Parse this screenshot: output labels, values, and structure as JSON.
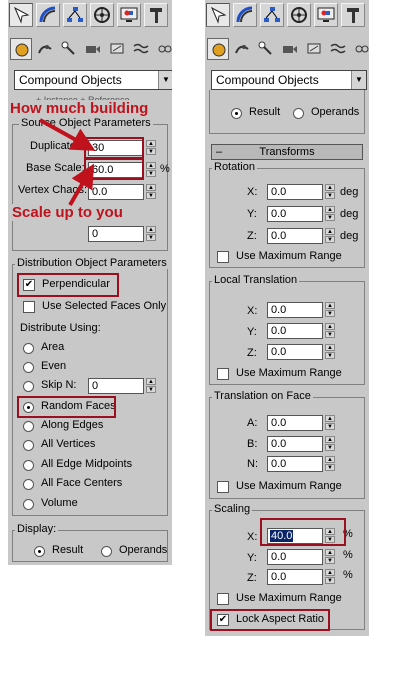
{
  "left": {
    "object_type": "Compound Objects",
    "source_params": {
      "title": "Source Object Parameters",
      "duplicates_label": "Duplicates:",
      "duplicates_value": "30",
      "base_scale_label": "Base Scale:",
      "base_scale_value": "60.0",
      "base_scale_unit": "%",
      "vertex_chaos_label": "Vertex Chaos:",
      "vertex_chaos_value": "0.0",
      "extra_field_value": "0"
    },
    "distribution": {
      "title": "Distribution Object Parameters",
      "perpendicular_label": "Perpendicular",
      "use_selected_faces_label": "Use Selected Faces Only",
      "distribute_using_label": "Distribute Using:",
      "area_label": "Area",
      "even_label": "Even",
      "skip_n_label": "Skip N:",
      "skip_n_value": "0",
      "random_faces_label": "Random Faces",
      "along_edges_label": "Along Edges",
      "all_vertices_label": "All Vertices",
      "all_edge_midpoints_label": "All Edge Midpoints",
      "all_face_centers_label": "All Face Centers",
      "volume_label": "Volume"
    },
    "display": {
      "title": "Display:",
      "result_label": "Result",
      "operands_label": "Operands"
    },
    "partial_overlay_text": "+ Instance  + Reference",
    "annotations": {
      "how_much": "How much building",
      "scale_up": "Scale up to you"
    }
  },
  "right": {
    "object_type": "Compound Objects",
    "top": {
      "result_label": "Result",
      "operands_label": "Operands"
    },
    "transforms_header": "Transforms",
    "rotation": {
      "title": "Rotation",
      "x_label": "X:",
      "x_value": "0.0",
      "y_label": "Y:",
      "y_value": "0.0",
      "z_label": "Z:",
      "z_value": "0.0",
      "unit": "deg",
      "use_max_label": "Use Maximum Range"
    },
    "local_translation": {
      "title": "Local Translation",
      "x_label": "X:",
      "x_value": "0.0",
      "y_label": "Y:",
      "y_value": "0.0",
      "z_label": "Z:",
      "z_value": "0.0",
      "use_max_label": "Use Maximum Range"
    },
    "translation_on_face": {
      "title": "Translation on Face",
      "a_label": "A:",
      "a_value": "0.0",
      "b_label": "B:",
      "b_value": "0.0",
      "n_label": "N:",
      "n_value": "0.0",
      "use_max_label": "Use Maximum Range"
    },
    "scaling": {
      "title": "Scaling",
      "x_label": "X:",
      "x_value": "40.0",
      "y_label": "Y:",
      "y_value": "0.0",
      "z_label": "Z:",
      "z_value": "0.0",
      "unit": "%",
      "use_max_label": "Use Maximum Range",
      "lock_aspect_label": "Lock Aspect Ratio"
    }
  },
  "colors": {
    "panel_bg": "#c8c8c8",
    "annotation_red": "#c0121c",
    "highlight_box": "#9b1020",
    "selection_blue": "#0a246a"
  }
}
